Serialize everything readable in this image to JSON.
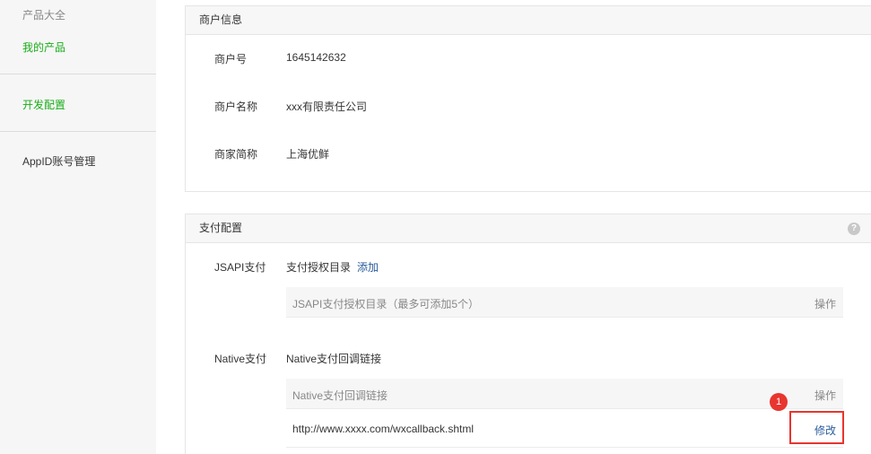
{
  "sidebar": {
    "items": [
      {
        "label": "产品大全"
      },
      {
        "label": "我的产品"
      },
      {
        "label": "开发配置"
      },
      {
        "label": "AppID账号管理"
      }
    ]
  },
  "merchant_panel": {
    "title": "商户信息",
    "rows": [
      {
        "label": "商户号",
        "value": "1645142632"
      },
      {
        "label": "商户名称",
        "value": "xxx有限责任公司"
      },
      {
        "label": "商家简称",
        "value": "上海优鲜"
      }
    ]
  },
  "payment_panel": {
    "title": "支付配置",
    "help_icon": "question-circle-icon",
    "jsapi": {
      "label": "JSAPI支付",
      "sub_label": "支付授权目录",
      "add_link": "添加",
      "table_header": "JSAPI支付授权目录（最多可添加5个）",
      "table_action": "操作"
    },
    "native": {
      "label": "Native支付",
      "sub_label": "Native支付回调链接",
      "table_header": "Native支付回调链接",
      "table_action": "操作",
      "url": "http://www.xxxx.com/wxcallback.shtml",
      "edit_link": "修改"
    }
  },
  "annotation": {
    "badge": "1",
    "color": "#e8352f"
  }
}
